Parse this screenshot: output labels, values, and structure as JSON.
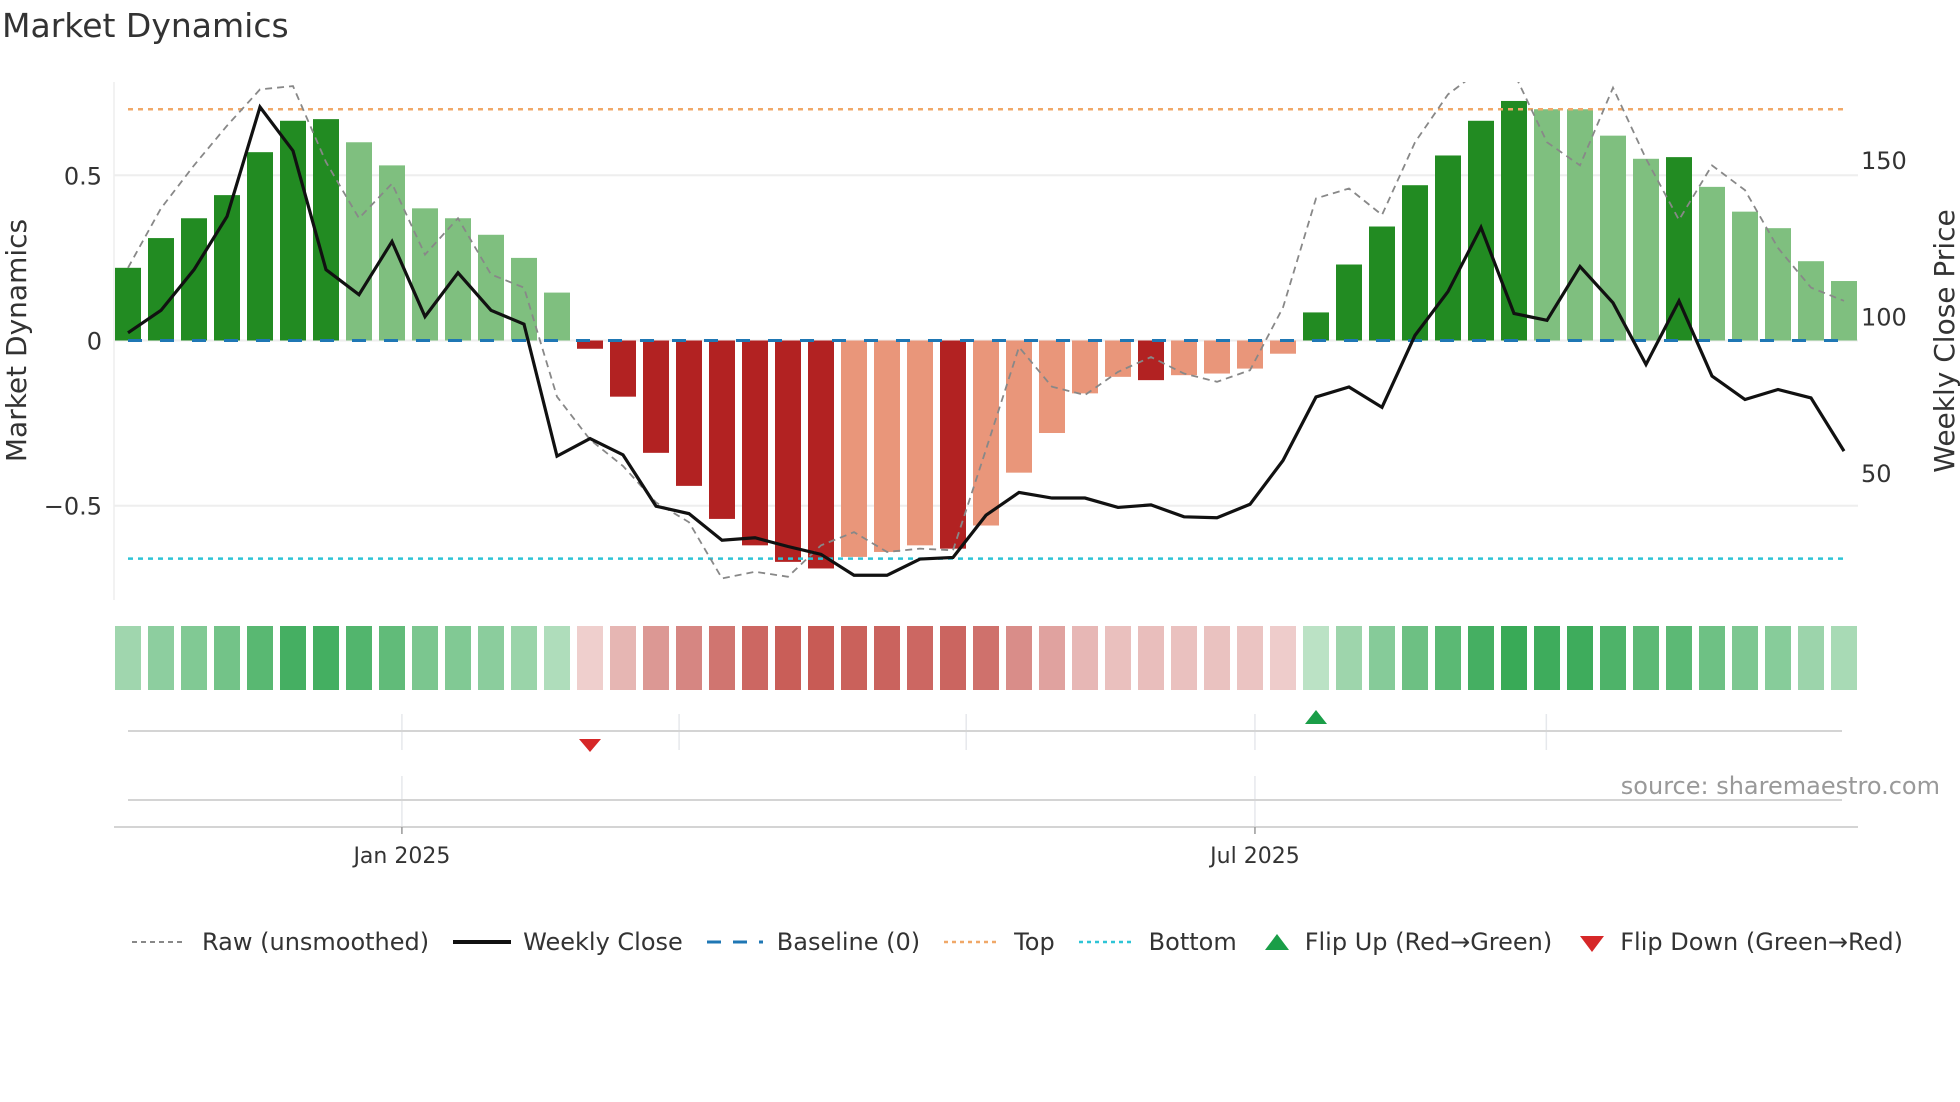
{
  "title": "Market Dynamics",
  "source": "source: sharemaestro.com",
  "colors": {
    "strong_green": "#228b22",
    "weak_green": "#7fbf7f",
    "strong_red": "#b22222",
    "weak_red": "#e9967a",
    "raw": "#888888",
    "close": "#111111",
    "baseline": "#1f77b4",
    "top": "#f0a868",
    "bottom": "#2ec4d6",
    "flip_up": "#1a9e48",
    "flip_down": "#d62728"
  },
  "legend": [
    {
      "key": "raw",
      "label": "Raw (unsmoothed)"
    },
    {
      "key": "close",
      "label": "Weekly Close"
    },
    {
      "key": "baseline",
      "label": "Baseline (0)"
    },
    {
      "key": "top",
      "label": "Top"
    },
    {
      "key": "bottom",
      "label": "Bottom"
    },
    {
      "key": "flip_up",
      "label": "Flip Up (Red→Green)"
    },
    {
      "key": "flip_down",
      "label": "Flip Down (Green→Red)"
    }
  ],
  "chart_data": {
    "type": "bar",
    "title": "Market Dynamics",
    "ylabel": "Market Dynamics",
    "y2label": "Weekly Close Price",
    "ylim": [
      -0.79,
      0.78
    ],
    "y2lim": [
      9,
      175
    ],
    "yticks": [
      {
        "v": 0.5,
        "label": "0.5"
      },
      {
        "v": 0,
        "label": "0"
      },
      {
        "v": -0.5,
        "label": "−0.5"
      }
    ],
    "y2ticks": [
      {
        "v": 150,
        "label": "150"
      },
      {
        "v": 100,
        "label": "100"
      },
      {
        "v": 50,
        "label": "50"
      }
    ],
    "xticks": [
      {
        "i": 8.3,
        "label": "Jan 2025"
      },
      {
        "i": 34.15,
        "label": "Jul 2025"
      }
    ],
    "minor_x_grid": [
      8.3,
      16.7,
      25.4,
      34.15,
      42.98
    ],
    "top_level": 0.7,
    "bottom_level": -0.66,
    "baseline": 0,
    "values": [
      0.22,
      0.31,
      0.37,
      0.44,
      0.57,
      0.665,
      0.67,
      0.6,
      0.53,
      0.4,
      0.37,
      0.32,
      0.25,
      0.145,
      -0.025,
      -0.17,
      -0.34,
      -0.44,
      -0.54,
      -0.62,
      -0.67,
      -0.69,
      -0.655,
      -0.64,
      -0.62,
      -0.63,
      -0.56,
      -0.4,
      -0.28,
      -0.16,
      -0.11,
      -0.12,
      -0.105,
      -0.1,
      -0.085,
      -0.04,
      0.085,
      0.23,
      0.345,
      0.47,
      0.56,
      0.665,
      0.725,
      0.7,
      0.7,
      0.62,
      0.55,
      0.555,
      0.465,
      0.39,
      0.34,
      0.24,
      0.18
    ],
    "strong": [
      1,
      1,
      1,
      1,
      1,
      1,
      1,
      0,
      0,
      0,
      0,
      0,
      0,
      0,
      1,
      1,
      1,
      1,
      1,
      1,
      1,
      1,
      0,
      0,
      0,
      1,
      0,
      0,
      0,
      0,
      0,
      1,
      0,
      0,
      0,
      0,
      1,
      1,
      1,
      1,
      1,
      1,
      1,
      0,
      0,
      0,
      0,
      1,
      0,
      0,
      0,
      0,
      0
    ],
    "raw": [
      0.22,
      0.4,
      0.53,
      0.65,
      0.76,
      0.77,
      0.54,
      0.37,
      0.475,
      0.26,
      0.37,
      0.2,
      0.16,
      -0.17,
      -0.3,
      -0.38,
      -0.49,
      -0.55,
      -0.72,
      -0.7,
      -0.715,
      -0.62,
      -0.58,
      -0.64,
      -0.63,
      -0.635,
      -0.33,
      -0.02,
      -0.14,
      -0.165,
      -0.095,
      -0.05,
      -0.1,
      -0.125,
      -0.09,
      0.1,
      0.43,
      0.46,
      0.38,
      0.6,
      0.745,
      0.82,
      0.81,
      0.6,
      0.53,
      0.765,
      0.55,
      0.365,
      0.53,
      0.455,
      0.28,
      0.16,
      0.12
    ],
    "weekly_close": [
      94.8,
      102,
      115,
      132,
      167,
      153,
      115,
      107,
      124,
      100,
      114,
      102,
      97.6,
      55.4,
      61,
      55.8,
      39.4,
      37,
      28.5,
      29.3,
      26.5,
      24,
      17.3,
      17.3,
      22.5,
      23,
      36.5,
      43.8,
      42,
      42,
      39,
      39.8,
      36,
      35.7,
      40,
      54,
      74.3,
      77.5,
      71,
      94,
      108,
      128.5,
      101,
      98.8,
      116,
      104.4,
      84.7,
      105,
      81,
      73.5,
      76.7,
      74,
      57
    ],
    "flips": [
      {
        "i": 14,
        "dir": "down"
      },
      {
        "i": 36,
        "dir": "up"
      }
    ]
  }
}
